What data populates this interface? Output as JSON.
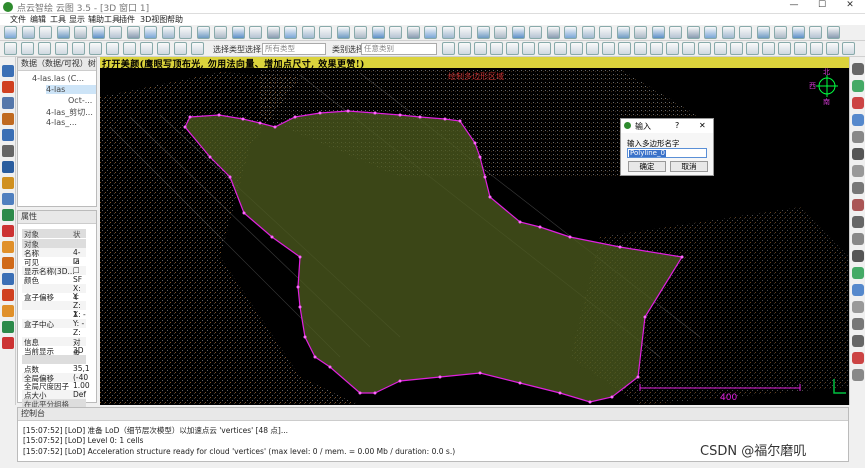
{
  "window": {
    "title": "点云智绘 云图 3.5 - [3D 窗口 1]",
    "controls": [
      "—",
      "☐",
      "✕"
    ]
  },
  "menu": [
    "文件",
    "编辑",
    "工具",
    "显示",
    "辅助工具",
    "插件",
    "3D视图",
    "帮助"
  ],
  "toolbar2": {
    "selection_type_label": "选择类型选择:",
    "selection_type_value": "所有类型",
    "category_label": "类别选择:",
    "category_value": "任意类别"
  },
  "db_panel": {
    "title": "数据（数据/可视）树",
    "rows": [
      {
        "label": "4-las.las (C..."
      },
      {
        "label": "4-las"
      },
      {
        "label": "Oct-..."
      },
      {
        "label": "4-las_剪切..."
      },
      {
        "label": "4-las_..."
      }
    ]
  },
  "properties": {
    "title": "属性",
    "header": {
      "k": "对象",
      "v": "状态"
    },
    "rows": [
      {
        "k": "对象",
        "v": "",
        "type": "hdr"
      },
      {
        "k": "名称",
        "v": "4-la"
      },
      {
        "k": "可见",
        "v": "☑"
      },
      {
        "k": "显示名称(3D...",
        "v": "☐"
      },
      {
        "k": "颜色",
        "v": "SF"
      },
      {
        "k": "",
        "v": "X: 4"
      },
      {
        "k": "盒子偏移",
        "v": "Y: 6"
      },
      {
        "k": "",
        "v": "Z: 1"
      },
      {
        "k": "",
        "v": "X: -"
      },
      {
        "k": "盒子中心",
        "v": "Y: -"
      },
      {
        "k": "",
        "v": "Z: 6"
      },
      {
        "k": "信息",
        "v": "对象"
      },
      {
        "k": "当前显示",
        "v": "3D"
      },
      {
        "k": "",
        "v": "",
        "type": "hdr"
      },
      {
        "k": "点数",
        "v": "35,1"
      },
      {
        "k": "全局偏移",
        "v": "(-40"
      },
      {
        "k": "全局尺度因子",
        "v": "1.00"
      },
      {
        "k": "点大小",
        "v": "Def"
      },
      {
        "k": "在此平分组格",
        "v": "",
        "type": "hdr"
      }
    ]
  },
  "viewport": {
    "banner": "打开美颜(鹰眼写顶布光, 勿用法向量、增加点尺寸, 效果更赞!)",
    "overlay_label": "绘制多边形区域",
    "compass_north": "北",
    "compass_west": "西",
    "compass_south": "南",
    "scale_label": "400"
  },
  "dialog": {
    "title": "输入",
    "help": "?",
    "close": "✕",
    "prompt": "输入多边形名字",
    "value": "Polyline_0",
    "ok": "确定",
    "cancel": "取消"
  },
  "console": {
    "title": "控制台",
    "lines": [
      "[15:07:52] [LoD] 准备 LoD（细节层次模型）以加速点云 'vertices' [48 点]...",
      "[15:07:52] [LoD] Level 0: 1 cells",
      "[15:07:52] [LoD] Acceleration structure ready for cloud 'vertices' (max level: 0 / mem. = 0.00 Mb / duration: 0.0 s.)"
    ]
  },
  "watermark": "CSDN @福尔磨叽",
  "colors": {
    "polygon_fill": "#4b5a1d",
    "polygon_edge": "#e020e0",
    "banner": "#dbd33c",
    "compass": "#00ff40"
  }
}
